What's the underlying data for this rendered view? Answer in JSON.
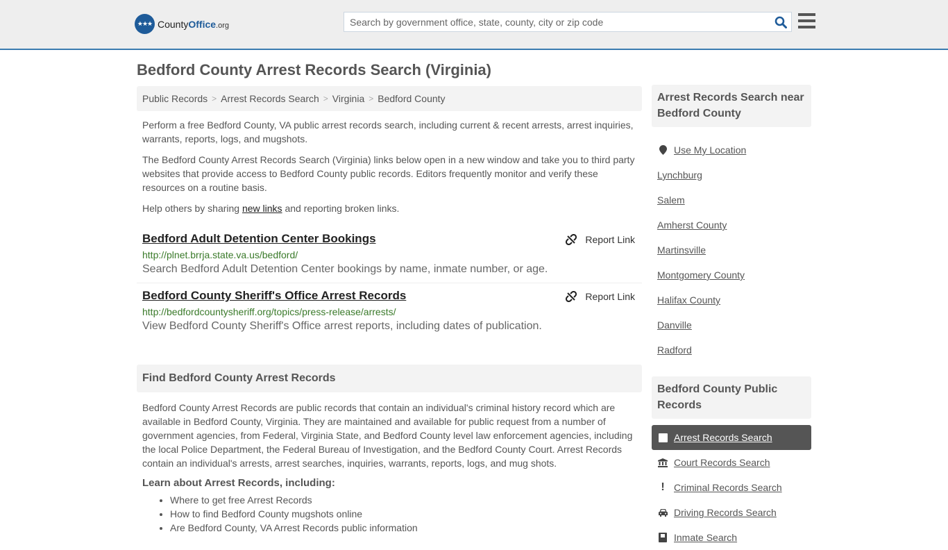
{
  "header": {
    "logo": {
      "county": "County",
      "office": "Office",
      "org": ".org",
      "badge_icon": "eagle-stars-icon"
    },
    "search": {
      "placeholder": "Search by government office, state, county, city or zip code",
      "value": ""
    },
    "colors": {
      "brand": "#1e5b99",
      "accent_bar": "#3b7bb0",
      "header_bg": "#eeeeee"
    }
  },
  "page": {
    "title": "Bedford County Arrest Records Search (Virginia)"
  },
  "breadcrumb": [
    "Public Records",
    "Arrest Records Search",
    "Virginia",
    "Bedford County"
  ],
  "intro": {
    "p1": "Perform a free Bedford County, VA public arrest records search, including current & recent arrests, arrest inquiries, warrants, reports, logs, and mugshots.",
    "p2": "The Bedford County Arrest Records Search (Virginia) links below open in a new window and take you to third party websites that provide access to Bedford County public records. Editors frequently monitor and verify these resources on a routine basis.",
    "p3_before": "Help others by sharing ",
    "p3_link": "new links",
    "p3_after": " and reporting broken links."
  },
  "links": [
    {
      "title": "Bedford Adult Detention Center Bookings",
      "url": "http://plnet.brrja.state.va.us/bedford/",
      "description": "Search Bedford Adult Detention Center bookings by name, inmate number, or age.",
      "report_label": "Report Link"
    },
    {
      "title": "Bedford County Sheriff's Office Arrest Records",
      "url": "http://bedfordcountysheriff.org/topics/press-release/arrests/",
      "description": "View Bedford County Sheriff's Office arrest reports, including dates of publication.",
      "report_label": "Report Link"
    }
  ],
  "find_section": {
    "heading": "Find Bedford County Arrest Records",
    "body": "Bedford County Arrest Records are public records that contain an individual's criminal history record which are available in Bedford County, Virginia. They are maintained and available for public request from a number of government agencies, from Federal, Virginia State, and Bedford County level law enforcement agencies, including the local Police Department, the Federal Bureau of Investigation, and the Bedford County Court. Arrest Records contain an individual's arrests, arrest searches, inquiries, warrants, reports, logs, and mug shots.",
    "learn_heading": "Learn about Arrest Records, including:",
    "learn_items": [
      "Where to get free Arrest Records",
      "How to find Bedford County mugshots online",
      "Are Bedford County, VA Arrest Records public information"
    ]
  },
  "sidebar": {
    "nearby_heading": "Arrest Records Search near Bedford County",
    "use_location": "Use My Location",
    "nearby": [
      "Lynchburg",
      "Salem",
      "Amherst County",
      "Martinsville",
      "Montgomery County",
      "Halifax County",
      "Danville",
      "Radford"
    ],
    "records_heading": "Bedford County Public Records",
    "records": [
      {
        "label": "Arrest Records Search",
        "icon": "square-icon",
        "active": true
      },
      {
        "label": "Court Records Search",
        "icon": "courthouse-icon",
        "active": false
      },
      {
        "label": "Criminal Records Search",
        "icon": "exclamation-icon",
        "active": false
      },
      {
        "label": "Driving Records Search",
        "icon": "car-icon",
        "active": false
      },
      {
        "label": "Inmate Search",
        "icon": "inmate-icon",
        "active": false
      }
    ]
  }
}
